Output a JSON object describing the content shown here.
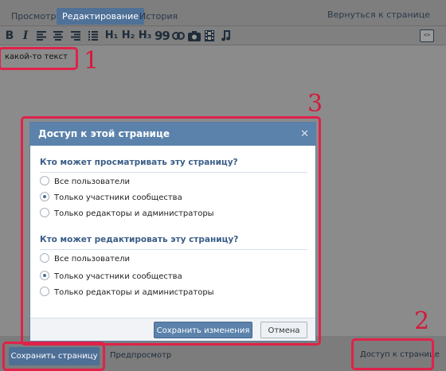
{
  "tabs": {
    "view": "Просмотр",
    "edit": "Редактирование",
    "history": "История",
    "back": "Вернуться к странице"
  },
  "toolbar": {
    "bold": "B",
    "italic": "I",
    "h1": "H₁",
    "h2": "H₂",
    "h3": "H₃",
    "quote": "99",
    "icons": [
      "bold-icon",
      "italic-icon",
      "align-left-icon",
      "align-center-icon",
      "align-right-icon",
      "list-icon",
      "h1-icon",
      "h2-icon",
      "h3-icon",
      "quote-icon",
      "link-icon",
      "camera-icon",
      "film-icon",
      "music-icon",
      "source-code-icon"
    ]
  },
  "editor": {
    "text": "какой-то текст"
  },
  "annotations": {
    "one": "1",
    "two": "2",
    "three": "3",
    "color": "#e0224a"
  },
  "modal": {
    "title": "Доступ к этой странице",
    "close": "✕",
    "view_section": {
      "title": "Кто может просматривать эту страницу?",
      "options": [
        "Все пользователи",
        "Только участники сообщества",
        "Только редакторы и администраторы"
      ],
      "selected_index": 1
    },
    "edit_section": {
      "title": "Кто может редактировать эту страницу?",
      "options": [
        "Все пользователи",
        "Только участники сообщества",
        "Только редакторы и администраторы"
      ],
      "selected_index": 1
    },
    "save": "Сохранить изменения",
    "cancel": "Отмена"
  },
  "bottom": {
    "save_page": "Сохранить страницу",
    "preview": "Предпросмотр",
    "access": "Доступ к странице"
  },
  "colors": {
    "accent": "#5b82ab",
    "highlight": "#e0224a"
  }
}
